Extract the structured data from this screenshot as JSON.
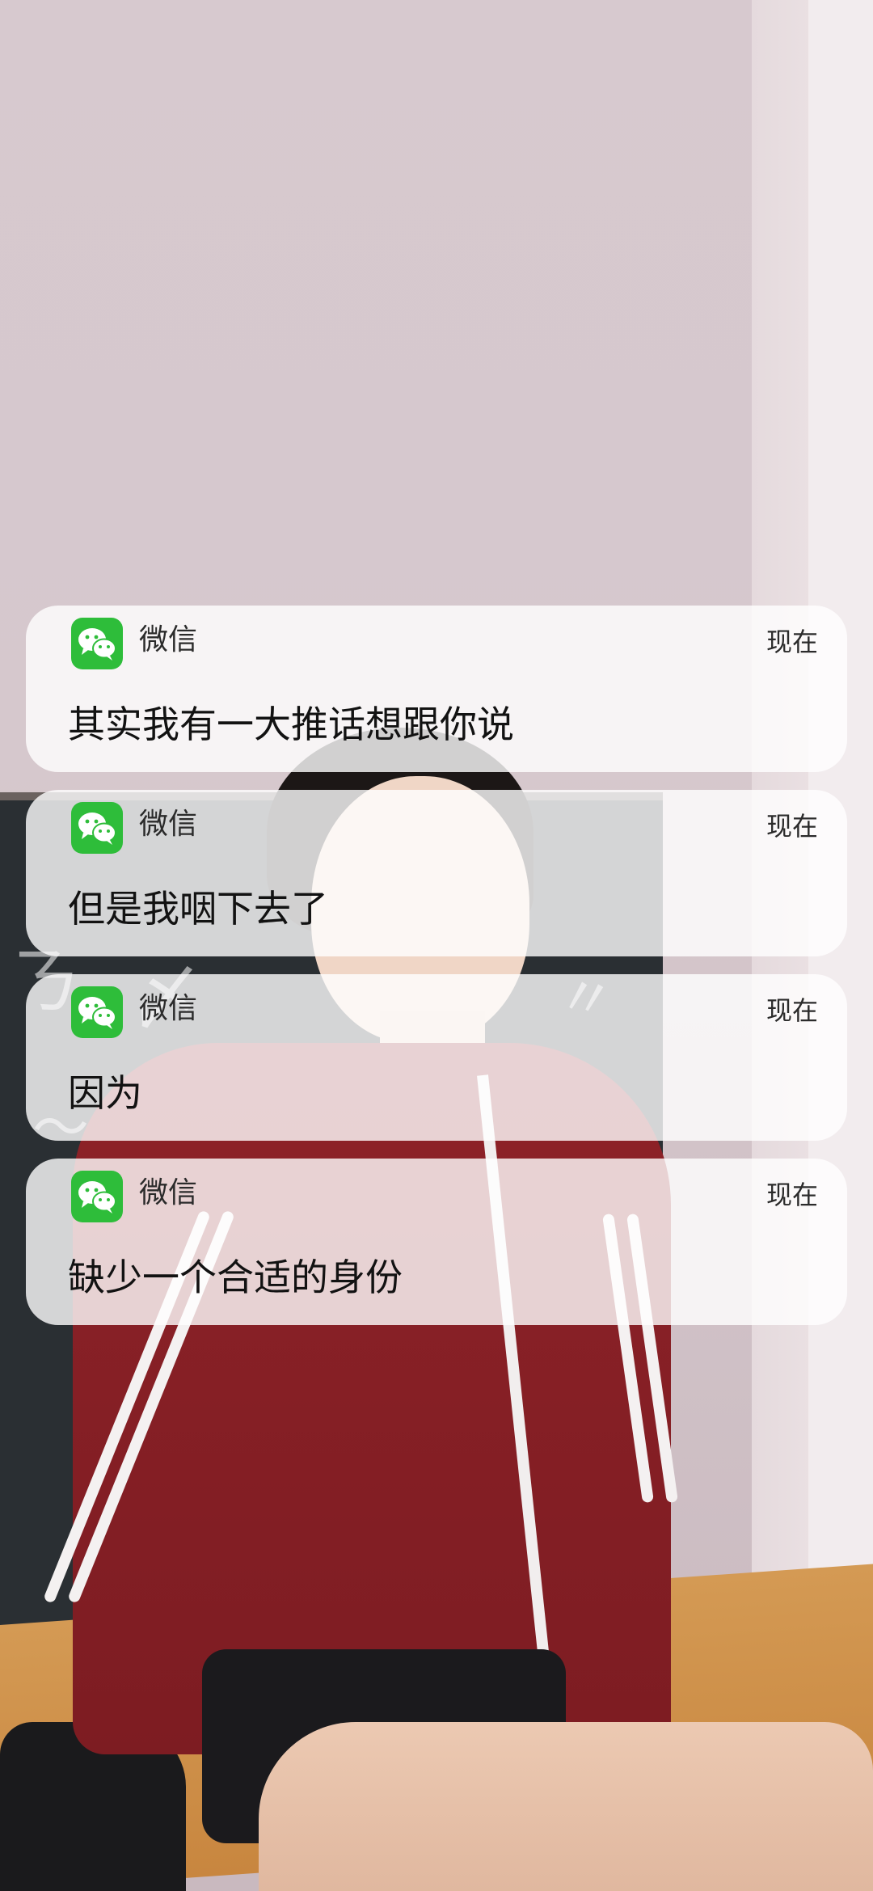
{
  "colors": {
    "notification_background": "#ffffffcc",
    "wechat_icon": "#2ebd3a"
  },
  "notifications": [
    {
      "app_name": "微信",
      "time": "现在",
      "message": "其实我有一大推话想跟你说",
      "icon": "wechat-icon"
    },
    {
      "app_name": "微信",
      "time": "现在",
      "message": "但是我咽下去了",
      "icon": "wechat-icon"
    },
    {
      "app_name": "微信",
      "time": "现在",
      "message": "因为",
      "icon": "wechat-icon"
    },
    {
      "app_name": "微信",
      "time": "现在",
      "message": "缺少一个合适的身份",
      "icon": "wechat-icon"
    }
  ]
}
